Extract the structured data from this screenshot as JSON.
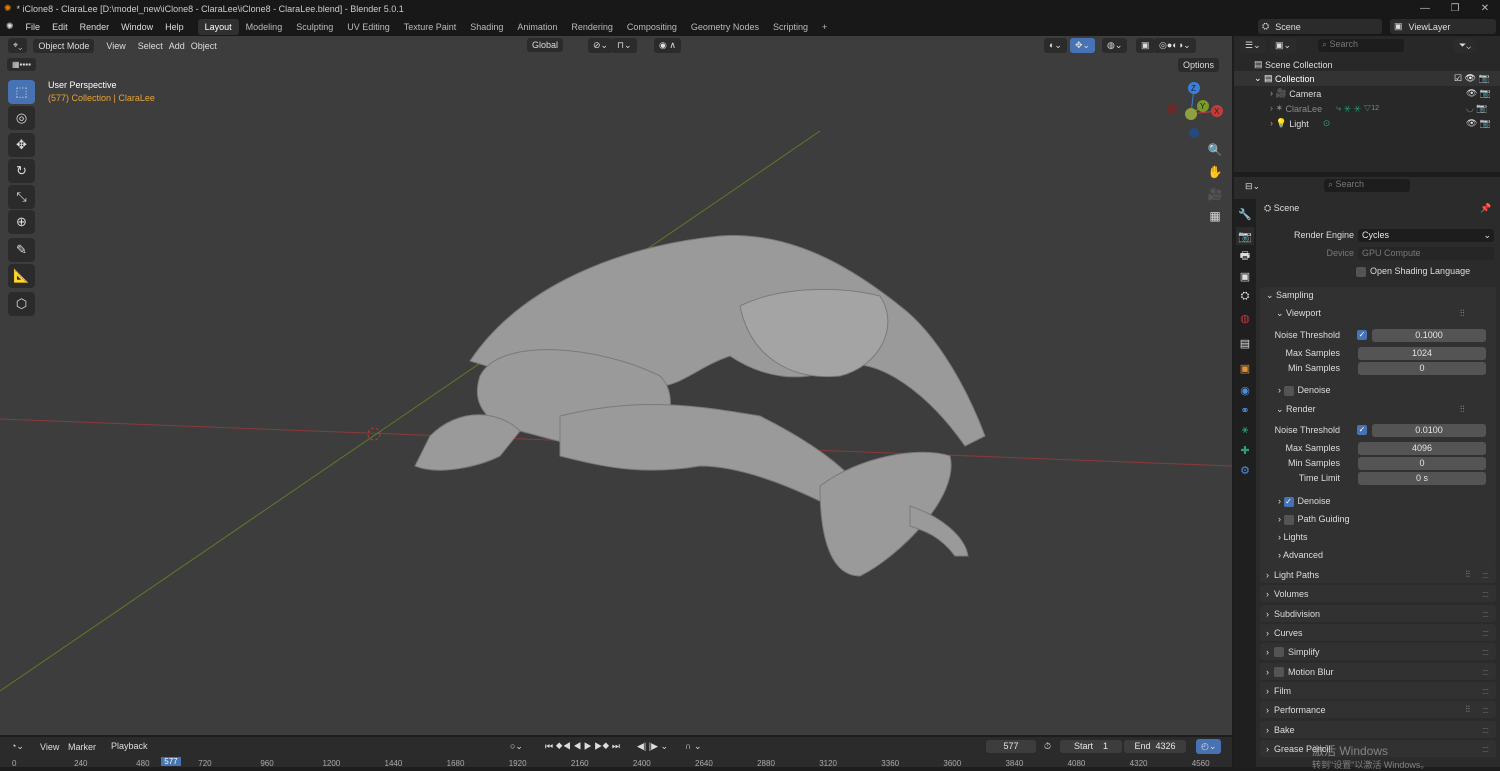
{
  "window": {
    "title": "* iClone8 - ClaraLee [D:\\model_new\\iClone8 - ClaraLee\\iClone8 - ClaraLee.blend] - Blender 5.0.1",
    "minimize": "—",
    "maximize": "❐",
    "close": "✕"
  },
  "menu": [
    "File",
    "Edit",
    "Render",
    "Window",
    "Help"
  ],
  "workspaces": [
    "Layout",
    "Modeling",
    "Sculpting",
    "UV Editing",
    "Texture Paint",
    "Shading",
    "Animation",
    "Rendering",
    "Compositing",
    "Geometry Nodes",
    "Scripting",
    "+"
  ],
  "active_workspace": "Layout",
  "scene_selector": {
    "scene": "Scene",
    "view_layer": "ViewLayer"
  },
  "viewport": {
    "mode": "Object Mode",
    "menus": [
      "View",
      "Select",
      "Add",
      "Object"
    ],
    "orientation": "Global",
    "options": "Options",
    "overlay_title": "User Perspective",
    "overlay_sub": "(577) Collection | ClaraLee",
    "gizmo": {
      "x": "X",
      "y": "Y",
      "z": "Z"
    }
  },
  "outliner": {
    "search_placeholder": "Search",
    "scene_collection": "Scene Collection",
    "collection": "Collection",
    "items": [
      {
        "name": "Camera"
      },
      {
        "name": "ClaraLee",
        "modifier_count": "12"
      },
      {
        "name": "Light"
      }
    ]
  },
  "properties": {
    "search_placeholder": "Search",
    "context": "Scene",
    "render_engine_label": "Render Engine",
    "render_engine": "Cycles",
    "device_label": "Device",
    "device": "GPU Compute",
    "osl": "Open Shading Language",
    "sampling": "Sampling",
    "viewport": "Viewport",
    "noise_threshold": "Noise Threshold",
    "vp_noise": "0.1000",
    "max_samples": "Max Samples",
    "vp_max": "1024",
    "min_samples": "Min Samples",
    "vp_min": "0",
    "denoise": "Denoise",
    "render": "Render",
    "r_noise": "0.0100",
    "r_max": "4096",
    "r_min": "0",
    "time_limit": "Time Limit",
    "r_time": "0 s",
    "path_guiding": "Path Guiding",
    "lights": "Lights",
    "advanced": "Advanced",
    "panels": [
      "Light Paths",
      "Volumes",
      "Subdivision",
      "Curves",
      "Simplify",
      "Motion Blur",
      "Film",
      "Performance",
      "Bake",
      "Grease Pencil"
    ]
  },
  "timeline": {
    "menus": [
      "View",
      "Marker",
      "Playback"
    ],
    "current_frame": "577",
    "start_label": "Start",
    "start": "1",
    "end_label": "End",
    "end": "4326",
    "ticks": [
      "0",
      "240",
      "480",
      "577",
      "720",
      "960",
      "1200",
      "1440",
      "1680",
      "1920",
      "2160",
      "2400",
      "2640",
      "2880",
      "3120",
      "3360",
      "3600",
      "3840",
      "4080",
      "4320",
      "4560"
    ]
  },
  "watermark": {
    "line1": "激活 Windows",
    "line2": "转到\"设置\"以激活 Windows。"
  },
  "colors": {
    "accent": "#4772b3",
    "active_text": "#e8a33a",
    "x_axis": "#c33c3c",
    "y_axis": "#7a9a2a",
    "z_axis": "#3b7fd9"
  }
}
